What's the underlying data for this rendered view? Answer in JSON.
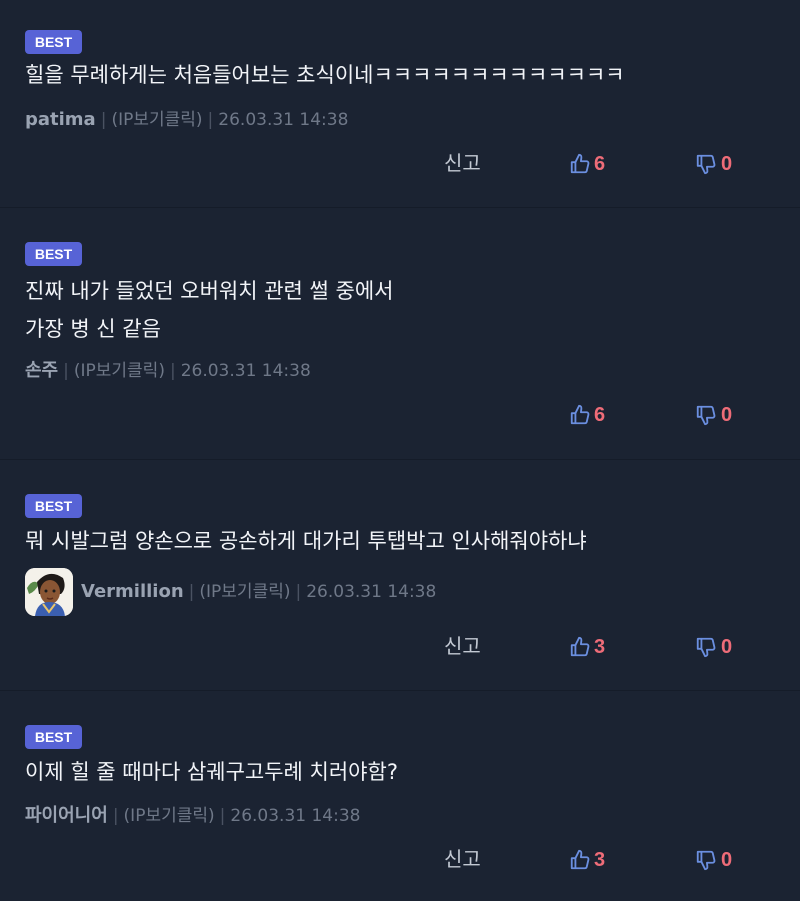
{
  "colors": {
    "background": "#1b2332",
    "badge": "#5763d6",
    "vote_count": "#ee6c78",
    "thumb_icon": "#6b8fe0"
  },
  "comments": [
    {
      "badge": "BEST",
      "lines": [
        "힐을 무례하게는 처음들어보는 초식이네ㅋㅋㅋㅋㅋㅋㅋㅋㅋㅋㅋㅋㅋ"
      ],
      "author": "patima",
      "ip": "(IP보기클릭)",
      "date": "26.03.31 14:38",
      "report": "신고",
      "likes": "6",
      "dislikes": "0",
      "icons": [
        "thumbs-up-icon",
        "thumbs-down-icon"
      ]
    },
    {
      "badge": "BEST",
      "lines": [
        "진짜 내가 들었던 오버워치 관련 썰 중에서",
        "가장 병 신 같음"
      ],
      "author": "손주",
      "ip": "(IP보기클릭)",
      "date": "26.03.31 14:38",
      "likes": "6",
      "dislikes": "0",
      "icons": [
        "thumbs-up-icon",
        "thumbs-down-icon"
      ]
    },
    {
      "badge": "BEST",
      "lines": [
        "뭐 시발그럼 양손으로 공손하게 대가리 투탭박고 인사해줘야하냐"
      ],
      "author": "Vermillion",
      "ip": "(IP보기클릭)",
      "date": "26.03.31 14:38",
      "report": "신고",
      "likes": "3",
      "dislikes": "0",
      "icons": [
        "avatar",
        "thumbs-up-icon",
        "thumbs-down-icon"
      ]
    },
    {
      "badge": "BEST",
      "lines": [
        "이제 힐 줄 때마다 삼궤구고두례 치러야함?"
      ],
      "author": "파이어니어",
      "ip": "(IP보기클릭)",
      "date": "26.03.31 14:38",
      "report": "신고",
      "likes": "3",
      "dislikes": "0",
      "icons": [
        "thumbs-up-icon",
        "thumbs-down-icon"
      ]
    }
  ]
}
